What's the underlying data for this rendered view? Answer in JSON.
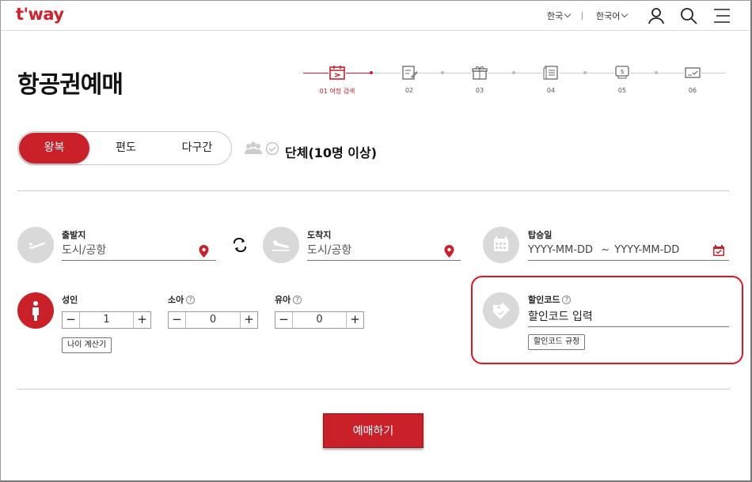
{
  "header": {
    "logo": "t'way",
    "region": "한국",
    "language": "한국어"
  },
  "page_title": "항공권예매",
  "steps": [
    {
      "label": "01 여정 검색",
      "active": true
    },
    {
      "label": "02",
      "active": false
    },
    {
      "label": "03",
      "active": false
    },
    {
      "label": "04",
      "active": false
    },
    {
      "label": "05",
      "active": false
    },
    {
      "label": "06",
      "active": false
    }
  ],
  "trip_type": {
    "options": [
      "왕복",
      "편도",
      "다구간"
    ],
    "selected": "왕복",
    "group_label": "단체(10명 이상)"
  },
  "departure": {
    "label": "출발지",
    "placeholder": "도시/공항"
  },
  "arrival": {
    "label": "도착지",
    "placeholder": "도시/공항"
  },
  "date": {
    "label": "탑승일",
    "from": "YYYY-MM-DD",
    "separator": "~",
    "to": "YYYY-MM-DD"
  },
  "passengers": {
    "adult": {
      "label": "성인",
      "value": "1"
    },
    "child": {
      "label": "소아",
      "value": "0",
      "help": "?"
    },
    "infant": {
      "label": "유아",
      "value": "0",
      "help": "?"
    },
    "minus": "−",
    "plus": "+",
    "age_calc": "나이 계산기"
  },
  "promo": {
    "label": "할인코드",
    "help": "?",
    "placeholder": "할인코드 입력",
    "rules_button": "할인코드 규정"
  },
  "submit": "예매하기",
  "colors": {
    "brand": "#c9202a",
    "highlight": "#e3141e"
  }
}
